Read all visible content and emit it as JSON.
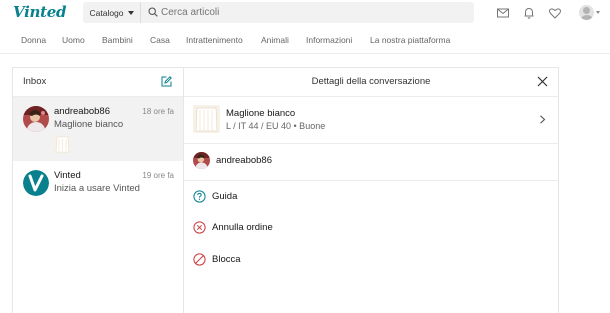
{
  "header": {
    "logo": "Vinted",
    "catalog_label": "Catalogo",
    "search_placeholder": "Cerca articoli"
  },
  "icons": {
    "search": "search-icon",
    "mail": "mail-icon",
    "bell": "bell-icon",
    "heart": "heart-icon",
    "avatar": "user-avatar-icon",
    "compose": "compose-icon",
    "close": "close-icon",
    "chevron": "chevron-right-icon",
    "help": "help-circle-icon",
    "cancel": "cancel-circle-icon",
    "block": "block-icon"
  },
  "nav": {
    "categories": [
      "Donna",
      "Uomo",
      "Bambini",
      "Casa",
      "Intrattenimento",
      "Animali",
      "Informazioni",
      "La nostra piattaforma"
    ]
  },
  "inbox": {
    "title": "Inbox",
    "conversations": [
      {
        "name": "andreabob86",
        "time": "18 ore fa",
        "message": "Maglione bianco"
      },
      {
        "name": "Vinted",
        "time": "19 ore fa",
        "message": "Inizia a usare Vinted"
      }
    ]
  },
  "details": {
    "title": "Dettagli della conversazione",
    "item": {
      "title": "Maglione bianco",
      "subtitle": "L / IT 44 / EU 40 • Buone"
    },
    "user": {
      "name": "andreabob86"
    },
    "actions": [
      {
        "label": "Guida"
      },
      {
        "label": "Annulla ordine"
      },
      {
        "label": "Blocca"
      }
    ]
  },
  "colors": {
    "brand": "#09808e",
    "help": "#09808e",
    "danger": "#cc3b3b",
    "selected_row": "#f2f2f2"
  }
}
